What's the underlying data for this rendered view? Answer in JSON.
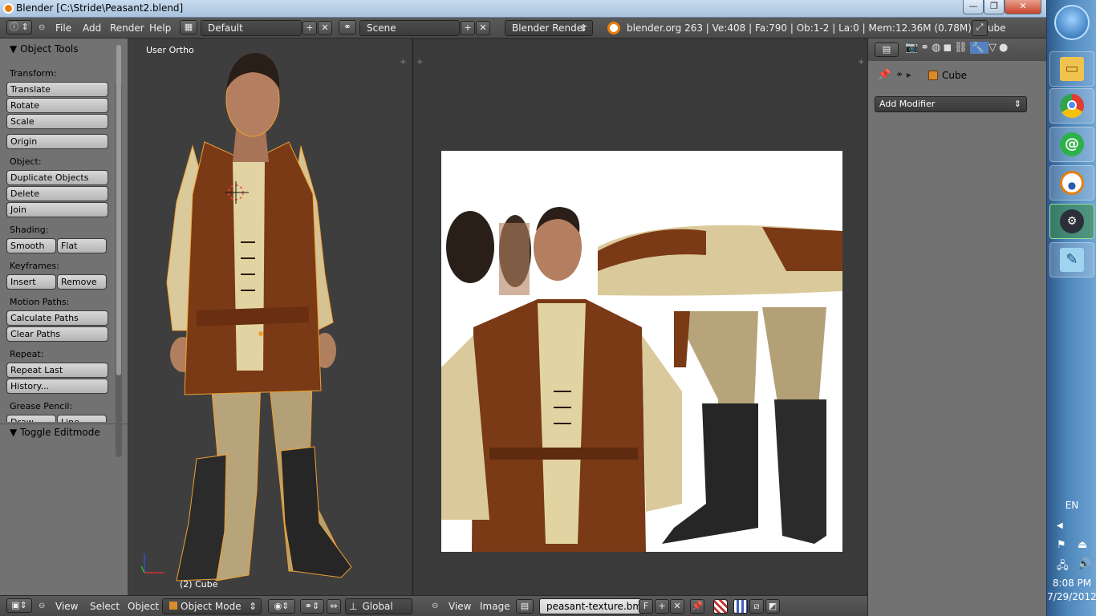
{
  "window": {
    "title": "Blender [C:\\Stride\\Peasant2.blend]",
    "minimize_label": "—",
    "maximize_label": "❐",
    "close_label": "✕"
  },
  "info_header": {
    "menus": [
      "File",
      "Add",
      "Render",
      "Help"
    ],
    "screen_layout": "Default",
    "scene": "Scene",
    "render_engine": "Blender Render",
    "stats": "blender.org 263 | Ve:408 | Fa:790 | Ob:1-2 | La:0 | Mem:12.36M (0.78M) | Cube"
  },
  "toolshelf": {
    "panel_title": "Object Tools",
    "transform_label": "Transform:",
    "translate": "Translate",
    "rotate": "Rotate",
    "scale": "Scale",
    "origin": "Origin",
    "object_label": "Object:",
    "duplicate_objects": "Duplicate Objects",
    "delete": "Delete",
    "join": "Join",
    "shading_label": "Shading:",
    "smooth": "Smooth",
    "flat": "Flat",
    "keyframes_label": "Keyframes:",
    "insert": "Insert",
    "remove": "Remove",
    "motion_paths_label": "Motion Paths:",
    "calculate_paths": "Calculate Paths",
    "clear_paths": "Clear Paths",
    "repeat_label": "Repeat:",
    "repeat_last": "Repeat Last",
    "history": "History...",
    "grease_pencil_label": "Grease Pencil:",
    "draw": "Draw",
    "line": "Line",
    "toggle_editmode": "Toggle Editmode"
  },
  "viewport3d": {
    "view_label": "User Ortho",
    "object_label": "(2) Cube"
  },
  "properties": {
    "object_name": "Cube",
    "add_modifier": "Add Modifier"
  },
  "bottom_3d": {
    "menus": [
      "View",
      "Select",
      "Object"
    ],
    "mode": "Object Mode",
    "orientation": "Global"
  },
  "bottom_uv": {
    "menus": [
      "View",
      "Image"
    ],
    "image_name": "peasant-texture.bmp",
    "fake_user": "F"
  },
  "taskbar": {
    "language": "EN",
    "time": "8:08 PM",
    "date": "7/29/2012",
    "apps": [
      "start-orb",
      "file-explorer",
      "chrome",
      "mail-agent",
      "blender",
      "steam",
      "notepad"
    ]
  },
  "colors": {
    "blender_orange": "#e87d0d",
    "selection_outline": "#f0a030"
  }
}
